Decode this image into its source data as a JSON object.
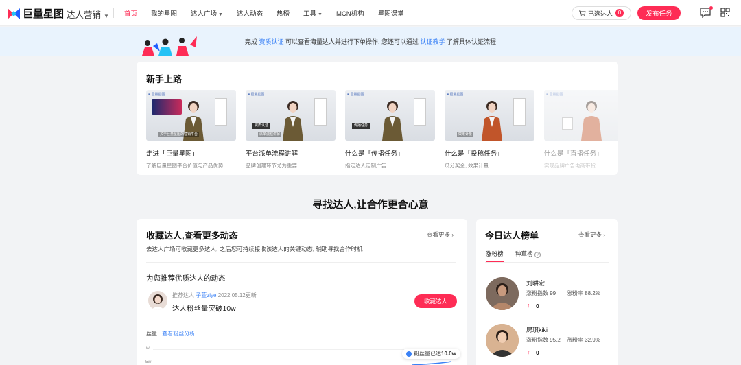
{
  "header": {
    "logo_text": "巨量星图",
    "product": "达人营销",
    "nav": [
      "首页",
      "我的星图",
      "达人广场",
      "达人动态",
      "热榜",
      "工具",
      "MCN机构",
      "星图课堂"
    ],
    "selected_label": "已选达人",
    "selected_count": "0",
    "publish_label": "发布任务"
  },
  "banner": {
    "prefix": "完成",
    "link1": "资质认证",
    "middle": "可以查看海量达人并进行下单操作,  您还可以通过",
    "link2": "认证教学",
    "suffix": "了解具体认证流程"
  },
  "newbie": {
    "title": "新手上路",
    "videos": [
      {
        "title": "走进「巨量星图」",
        "desc": "了解巨量星图平台价值与产品优势"
      },
      {
        "title": "平台派单流程讲解",
        "desc": "品牌创建环节尤为重要"
      },
      {
        "title": "什么是「传播任务」",
        "desc": "指定达人定制广告"
      },
      {
        "title": "什么是「投稿任务」",
        "desc": "瓜分奖金, 效果计量"
      },
      {
        "title": "什么是「直播任务」",
        "desc": "实现品牌广告电商带货"
      }
    ]
  },
  "section_title": "寻找达人,让合作更合心意",
  "favorites": {
    "title": "收藏达人,查看更多动态",
    "more": "查看更多",
    "desc": "去达人广场可收藏更多达人, 之后您可持续接收该达人的关键动态, 辅助寻找合作时机",
    "rec_title": "为您推荐优质达人的动态",
    "rec_meta_prefix": "推荐达人",
    "rec_name": "子萱ziye",
    "rec_date": "2022.05.12更新",
    "rec_text": "达人粉丝量突破10w",
    "collect_label": "收藏达人",
    "chart_label": "丝量",
    "chart_link": "查看粉丝分析",
    "axis_w": "w",
    "axis_5w": "5w",
    "callout_prefix": "粉丝量已达",
    "callout_value": "10.0w"
  },
  "ranking": {
    "title": "今日达人榜单",
    "more": "查看更多",
    "tabs": [
      "涨粉榜",
      "种草榜"
    ],
    "items": [
      {
        "name": "刘畊宏",
        "index_label": "涨粉指数",
        "index": "99",
        "rate_label": "涨粉率",
        "rate": "88.2%",
        "change": "0"
      },
      {
        "name": "房琪kiki",
        "index_label": "涨粉指数",
        "index": "95.2",
        "rate_label": "涨粉率",
        "rate": "32.9%",
        "change": "0"
      }
    ]
  },
  "colors": {
    "accent": "#fe2c55",
    "link": "#3b82f6",
    "banner_bg": "#e9f3fd"
  }
}
